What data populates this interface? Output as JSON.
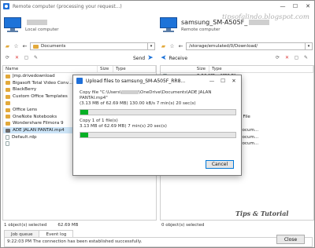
{
  "window": {
    "title": "Remote computer (processing your request...)",
    "minimize": "—",
    "maximize": "☐",
    "close": "✕"
  },
  "watermark_site": "tipsofalindo.blogspot.com",
  "local": {
    "name": "",
    "label": "Local computer",
    "path": "Documents"
  },
  "remote": {
    "name": "samsung_SM-A505F_",
    "label": "Remote computer",
    "path": "/storage/emulated/0/Download/"
  },
  "transfer": {
    "send_label": "Send",
    "receive_label": "Receive"
  },
  "left_panel": {
    "columns": [
      "Name",
      "Size",
      "Type"
    ],
    "rows": [
      {
        "name": "Jmp.drivedownload",
        "size": "",
        "icon": "folder"
      },
      {
        "name": "Bigasoft Total Video Conv...",
        "size": "",
        "icon": "folder"
      },
      {
        "name": "BlackBerry",
        "size": "",
        "icon": "folder"
      },
      {
        "name": "Custom Office Templates",
        "size": "",
        "icon": "folder"
      },
      {
        "name": "",
        "size": "",
        "icon": "folder"
      },
      {
        "name": "Office Lens",
        "size": "",
        "icon": "folder"
      },
      {
        "name": "OneNote Notebooks",
        "size": "",
        "icon": "folder"
      },
      {
        "name": "Wondershare Filmora 9",
        "size": "",
        "icon": "folder"
      },
      {
        "name": "ADE JALAN PANTAI.mp4",
        "size": "62",
        "icon": "video",
        "selected": true
      },
      {
        "name": "Default.rdp",
        "size": "",
        "icon": "file"
      },
      {
        "name": "",
        "size": "",
        "icon": "file"
      }
    ]
  },
  "right_panel": {
    "columns": [
      "Size",
      "Type"
    ],
    "rows": [
      {
        "size": "5.56 MB",
        "type": "MP3 File",
        "icon": "file"
      },
      {
        "size": "5.77 MB",
        "type": "MP3 File",
        "icon": "file"
      },
      {
        "size": "6.27 MB",
        "type": "MP3 File",
        "icon": "file"
      },
      {
        "size": "136 kB",
        "type": "JPG File",
        "icon": "image"
      },
      {
        "size": "4.64 MB",
        "type": "MP3 File",
        "icon": "file"
      },
      {
        "size": "5.18 MB",
        "type": "MP3 File",
        "icon": "file"
      },
      {
        "size": "4.40 MB",
        "type": "iCalendar File",
        "icon": "cal"
      },
      {
        "size": "17 kB",
        "type": "JPG File",
        "icon": "image"
      },
      {
        "size": "154 kB",
        "type": "MHTML Docum...",
        "icon": "mhtml"
      },
      {
        "size": "33 kB",
        "type": "MHTML Docum...",
        "icon": "mhtml"
      },
      {
        "size": "36 kB",
        "type": "MHTML Docum...",
        "icon": "mhtml"
      }
    ]
  },
  "status": {
    "left_selected": "1 object(s) selected",
    "left_size": "62.69 MB",
    "right_selected": "0 object(s) selected"
  },
  "tabs": [
    "Job queue",
    "Event log"
  ],
  "log": {
    "line": "9:22:03 PM The connection has been established successfully."
  },
  "brand_watermark": "Tips & Tutorial",
  "close_button": "Close",
  "dialog": {
    "title": "Upload files to samsung_SM-A505F_RR8...",
    "minimize": "—",
    "maximize": "☐",
    "close": "✕",
    "file_line1": "Copy file \"C:\\Users\\",
    "file_line1_rest": "\\OneDrive\\Documents\\ADE JALAN",
    "file_line2": "PANTAI.mp4\"",
    "file_stats": "(3.13 MB of 62.69 MB)     130.00 kB/s    7 min(s) 20 sec(s)",
    "file_progress": 0.05,
    "total_line1": "Copy 1 of 1 file(s)",
    "total_stats": "3.13 MB of 62.69 MB)     7 min(s) 20 sec(s)",
    "total_progress": 0.05,
    "cancel": "Cancel"
  }
}
